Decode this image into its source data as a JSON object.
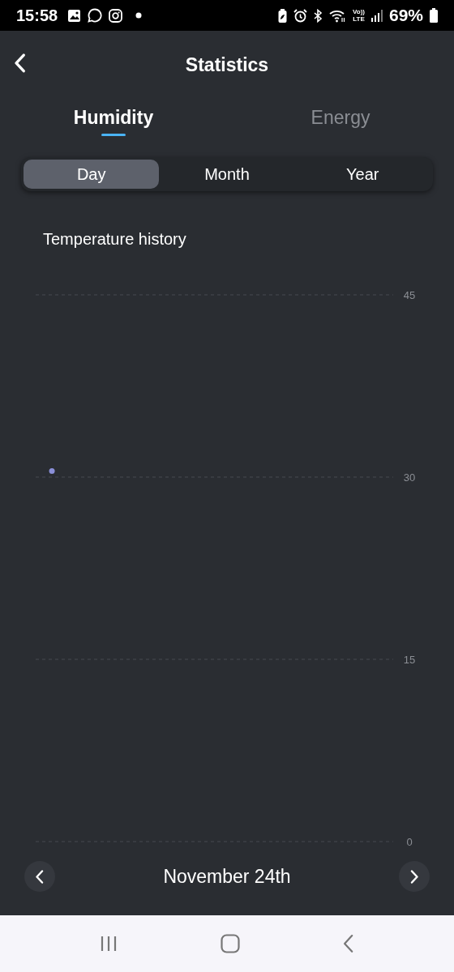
{
  "status_bar": {
    "time": "15:58",
    "volte_top": "Vo))",
    "volte_bottom": "LTE",
    "battery": "69%"
  },
  "header": {
    "title": "Statistics"
  },
  "tabs": [
    {
      "label": "Humidity",
      "selected": true
    },
    {
      "label": "Energy",
      "selected": false
    }
  ],
  "periods": [
    {
      "label": "Day",
      "selected": true
    },
    {
      "label": "Month",
      "selected": false
    },
    {
      "label": "Year",
      "selected": false
    }
  ],
  "chart_data": {
    "type": "scatter",
    "title": "Temperature history",
    "categories": [
      null,
      null,
      null,
      null,
      null,
      null,
      null,
      null,
      null,
      null,
      null
    ],
    "ylim": [
      0,
      45
    ],
    "yticks": [
      0,
      15,
      30,
      45
    ],
    "series": [
      {
        "color": "#8a8fd8",
        "values": [
          30.5,
          null,
          null,
          null,
          null,
          null,
          null,
          null,
          null,
          null,
          null
        ]
      }
    ]
  },
  "date_nav": {
    "date": "November 24th"
  }
}
